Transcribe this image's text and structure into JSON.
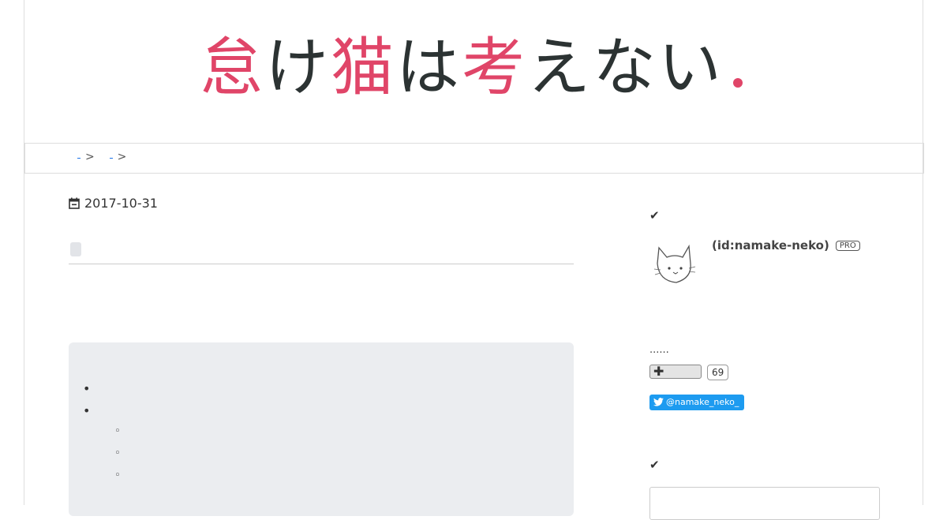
{
  "header": {
    "logo_text": [
      {
        "ch": "怠",
        "color": "#e04568"
      },
      {
        "ch": "け",
        "color": "#2c3333"
      },
      {
        "ch": "猫",
        "color": "#e04568"
      },
      {
        "ch": "は",
        "color": "#2c3333"
      },
      {
        "ch": "考",
        "color": "#e04568"
      },
      {
        "ch": "え",
        "color": "#2c3333"
      },
      {
        "ch": "な",
        "color": "#2c3333"
      },
      {
        "ch": "い",
        "color": "#2c3333"
      }
    ],
    "logo_dot_color": "#e04568"
  },
  "breadcrumb": {
    "separator_1": ">",
    "separator_2": ">"
  },
  "article": {
    "date": "2017-10-31"
  },
  "sidebar": {
    "check_1": "✔",
    "profile_id": "(id:namake-neko)",
    "pro_badge": "PRO",
    "dots": "......",
    "star_symbol": "✚",
    "star_count": "69",
    "twitter_handle": "@namake_neko_",
    "check_2": "✔"
  },
  "colors": {
    "accent_pink": "#e04568",
    "logo_dark": "#2c3333",
    "twitter_blue": "#1d9bf0"
  }
}
